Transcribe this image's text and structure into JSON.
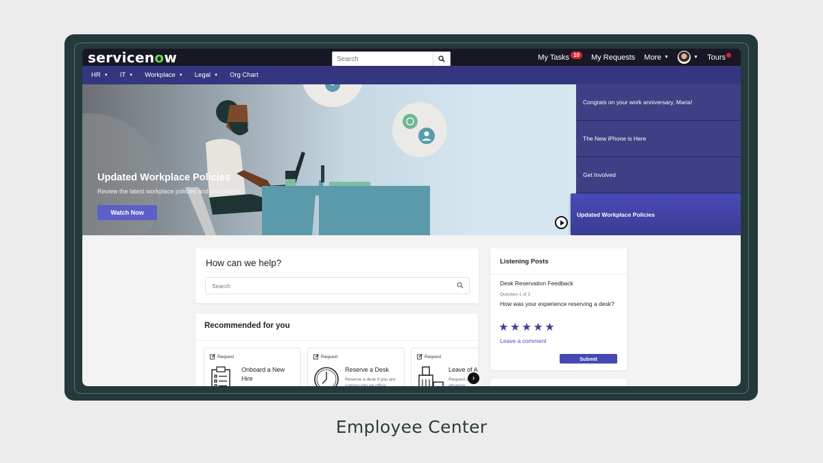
{
  "header": {
    "brand": {
      "text_prefix": "servicen",
      "text_o": "o",
      "text_suffix": "w"
    },
    "search": {
      "placeholder": "Search"
    },
    "links": {
      "my_tasks": "My Tasks",
      "my_tasks_badge": "10",
      "my_requests": "My Requests",
      "more": "More",
      "tours": "Tours"
    }
  },
  "nav": {
    "items": [
      {
        "label": "HR",
        "dropdown": true
      },
      {
        "label": "IT",
        "dropdown": true
      },
      {
        "label": "Workplace",
        "dropdown": true
      },
      {
        "label": "Legal",
        "dropdown": true
      },
      {
        "label": "Org Chart",
        "dropdown": false
      }
    ]
  },
  "hero": {
    "title": "Updated Workplace Policies",
    "subtitle": "Review the latest workplace policies and procedures.",
    "button": "Watch Now",
    "news": [
      "Congrats on your work anniversary, Maria!",
      "The New iPhone is Here",
      "Get Involved"
    ],
    "active_news": "Updated Workplace Policies"
  },
  "help": {
    "title": "How can we help?",
    "search_placeholder": "Search"
  },
  "recommended": {
    "title": "Recommended for you",
    "tiles": [
      {
        "tag": "Request",
        "title": "Onboard a New Hire",
        "desc": "",
        "icon": "clipboard-icon"
      },
      {
        "tag": "Request",
        "title": "Reserve a Desk",
        "desc": "Reserve a desk if you are coming into an office",
        "icon": "clock-icon"
      },
      {
        "tag": "Request",
        "title": "Leave of Absence",
        "desc": "Request a leave of absence",
        "icon": "luggage-icon"
      }
    ]
  },
  "listening_posts": {
    "title": "Listening Posts",
    "survey_title": "Desk Reservation Feedback",
    "question_number": "Question 1 of 3",
    "question": "How was your experience reserving a desk?",
    "rating_max": 5,
    "comment_link": "Leave a comment",
    "submit": "Submit"
  },
  "caption": "Employee Center",
  "colors": {
    "navbar": "#343680",
    "topbar": "#181825",
    "accent": "#5e5ec9",
    "news_panel": "#3e3f85",
    "frame": "#24393a",
    "badge": "#d5242f"
  }
}
